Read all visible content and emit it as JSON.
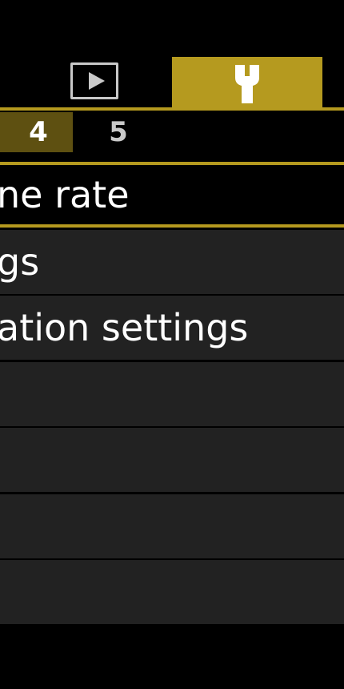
{
  "tabs": {
    "playback_icon": "playback-icon",
    "setup_icon": "wrench-icon",
    "accent_color": "#b59a1f"
  },
  "subtabs": {
    "active": "4",
    "next": "5"
  },
  "menu": {
    "items": [
      {
        "label": "ne rate",
        "selected": true
      },
      {
        "label": "gs",
        "selected": false
      },
      {
        "label": "ation settings",
        "selected": false
      },
      {
        "label": "",
        "selected": false
      },
      {
        "label": "",
        "selected": false
      },
      {
        "label": "",
        "selected": false
      },
      {
        "label": "",
        "selected": false
      }
    ]
  }
}
